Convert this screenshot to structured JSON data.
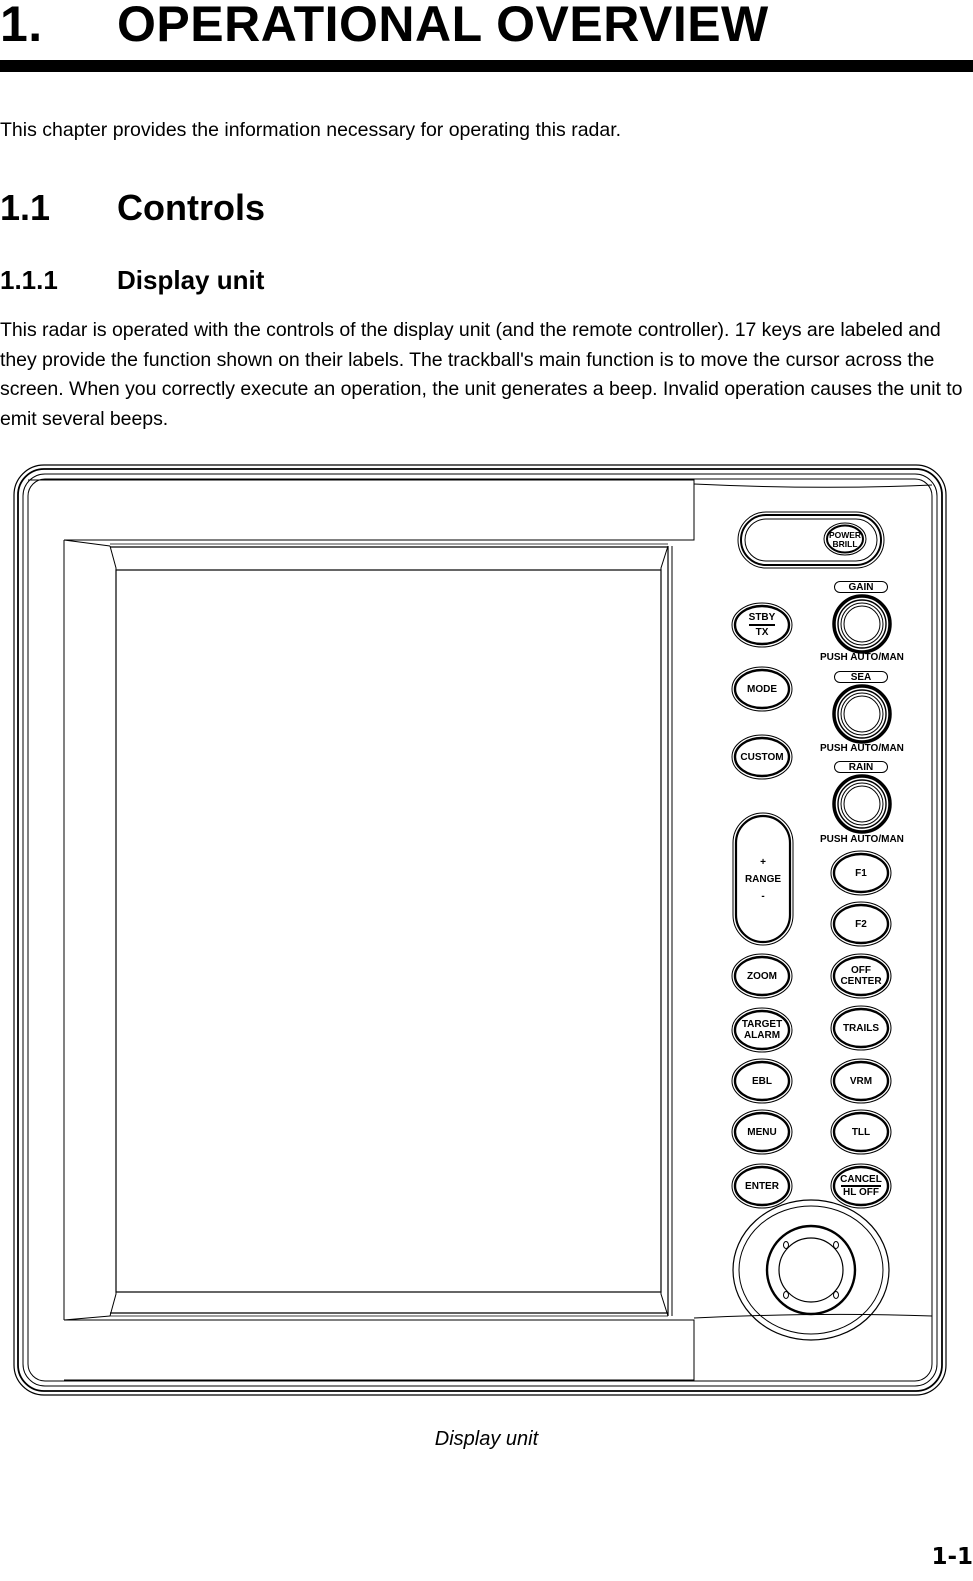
{
  "chapter": {
    "number": "1.",
    "title": "OPERATIONAL OVERVIEW",
    "intro": "This chapter provides the information necessary for operating this radar."
  },
  "section": {
    "number": "1.1",
    "title": "Controls"
  },
  "subsection": {
    "number": "1.1.1",
    "title": "Display unit",
    "body": "This radar is operated with the controls of the display unit (and the remote controller). 17 keys are labeled and they provide the function shown on their labels. The trackball's main function is to move the cursor across the screen. When you correctly execute an operation, the unit generates a beep. Invalid operation causes the unit to emit several beeps."
  },
  "figure": {
    "caption": "Display unit",
    "power_key": {
      "line1": "POWER",
      "line2": "BRILL"
    },
    "knobs": [
      {
        "label": "GAIN",
        "sub": "PUSH AUTO/MAN"
      },
      {
        "label": "SEA",
        "sub": "PUSH AUTO/MAN"
      },
      {
        "label": "RAIN",
        "sub": "PUSH AUTO/MAN"
      }
    ],
    "left_keys": {
      "stby_tx": {
        "line1": "STBY",
        "line2": "TX"
      },
      "mode": "MODE",
      "custom": "CUSTOM",
      "range": {
        "plus": "+",
        "label": "RANGE",
        "minus": "-"
      },
      "zoom": "ZOOM",
      "target_alarm": {
        "line1": "TARGET",
        "line2": "ALARM"
      },
      "ebl": "EBL",
      "menu": "MENU",
      "enter": "ENTER"
    },
    "right_keys": {
      "f1": "F1",
      "f2": "F2",
      "off_center": {
        "line1": "OFF",
        "line2": "CENTER"
      },
      "trails": "TRAILS",
      "vrm": "VRM",
      "tll": "TLL",
      "cancel_hl_off": {
        "line1": "CANCEL",
        "line2": "HL OFF"
      }
    }
  },
  "page": {
    "number": "1-1"
  }
}
